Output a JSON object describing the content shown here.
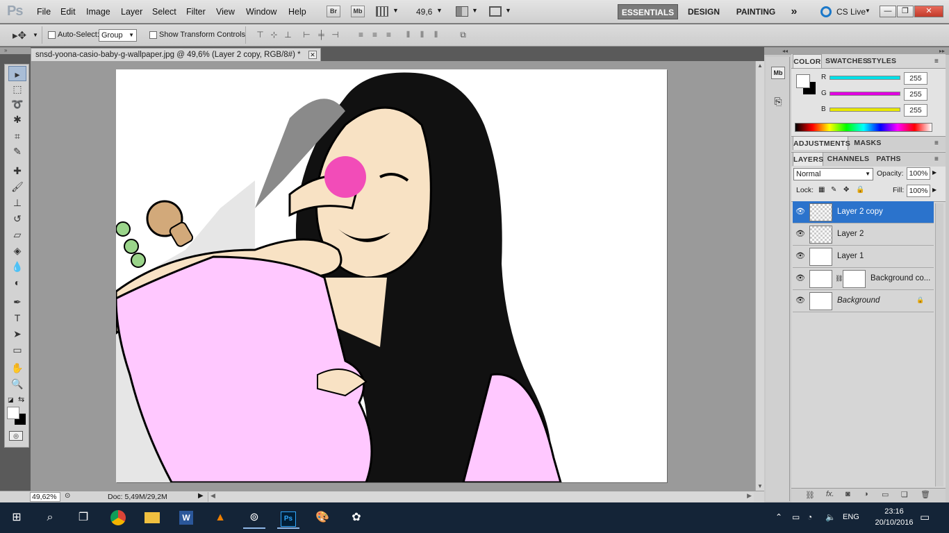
{
  "app": {
    "logo": "Ps"
  },
  "menu": [
    "File",
    "Edit",
    "Image",
    "Layer",
    "Select",
    "Filter",
    "View",
    "Window",
    "Help"
  ],
  "appbar": {
    "bridge": "Br",
    "minibridge": "Mb",
    "zoom": "49,6"
  },
  "workspaces": [
    "ESSENTIALS",
    "DESIGN",
    "PAINTING"
  ],
  "workspace_more": "»",
  "cslive": "CS Live",
  "options": {
    "autoselect_label": "Auto-Select:",
    "autoselect_value": "Group",
    "transform_label": "Show Transform Controls"
  },
  "document": {
    "tab_title": "snsd-yoona-casio-baby-g-wallpaper.jpg @ 49,6% (Layer 2 copy, RGB/8#) *"
  },
  "status": {
    "zoom": "49,62%",
    "doc": "Doc: 5,49M/29,2M"
  },
  "color_panel": {
    "tabs": [
      "COLOR",
      "SWATCHES",
      "STYLES"
    ],
    "channels": [
      {
        "name": "R",
        "value": "255",
        "color": "#00e0e8"
      },
      {
        "name": "G",
        "value": "255",
        "color": "#e000e0"
      },
      {
        "name": "B",
        "value": "255",
        "color": "#e8e800"
      }
    ]
  },
  "adjust_tabs": [
    "ADJUSTMENTS",
    "MASKS"
  ],
  "layers_panel": {
    "tabs": [
      "LAYERS",
      "CHANNELS",
      "PATHS"
    ],
    "blend": "Normal",
    "opacity_label": "Opacity:",
    "opacity": "100%",
    "lock_label": "Lock:",
    "fill_label": "Fill:",
    "fill": "100%",
    "layers": [
      {
        "name": "Layer 2 copy",
        "active": true
      },
      {
        "name": "Layer 2",
        "active": false
      },
      {
        "name": "Layer 1",
        "active": false
      },
      {
        "name": "Background co...",
        "active": false
      },
      {
        "name": "Background",
        "active": false
      }
    ]
  },
  "taskbar": {
    "lang": "ENG",
    "time": "23:16",
    "date": "20/10/2016"
  }
}
